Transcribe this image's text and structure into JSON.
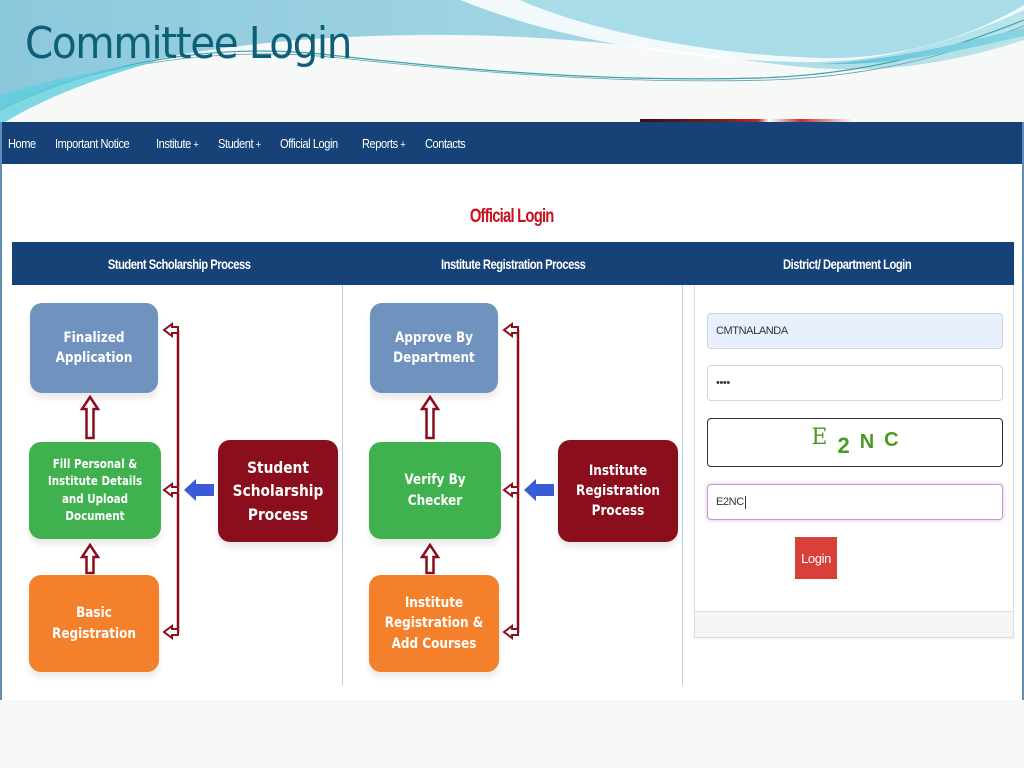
{
  "slide": {
    "title": "Committee Login"
  },
  "navbar": {
    "items": [
      {
        "label": "Home",
        "has_submenu": false
      },
      {
        "label": "Important Notice",
        "has_submenu": false
      },
      {
        "label": "Institute",
        "has_submenu": true
      },
      {
        "label": "Student",
        "has_submenu": true
      },
      {
        "label": "Official Login",
        "has_submenu": false
      },
      {
        "label": "Reports",
        "has_submenu": true
      },
      {
        "label": "Contacts",
        "has_submenu": false
      }
    ],
    "submenu_glyph": "+"
  },
  "page": {
    "heading": "Official Login",
    "tabs": [
      {
        "label": "Student Scholarship Process"
      },
      {
        "label": "Institute Registration Process"
      },
      {
        "label": "District/ Department Login"
      }
    ]
  },
  "student_flow": {
    "steps": [
      {
        "label": "Finalized Application",
        "color": "#6f93be"
      },
      {
        "label": "Fill Personal & Institute Details and Upload Document",
        "color": "#3fb14f"
      },
      {
        "label": "Basic Registration",
        "color": "#f5802b"
      }
    ],
    "source": {
      "label": "Student Scholarship Process",
      "color": "#8a0e1c"
    }
  },
  "institute_flow": {
    "steps": [
      {
        "label": "Approve By Department",
        "color": "#6f93be"
      },
      {
        "label": "Verify By Checker",
        "color": "#3fb14f"
      },
      {
        "label": "Institute Registration & Add Courses",
        "color": "#f5802b"
      }
    ],
    "source": {
      "label": "Institute Registration Process",
      "color": "#8a0e1c"
    }
  },
  "login": {
    "username_value": "CMTNALANDA",
    "password_value": "••••",
    "captcha_chars": [
      "E",
      "2",
      "N",
      "C"
    ],
    "captcha_input_value": "E2NC",
    "submit_label": "Login"
  },
  "colors": {
    "nav_bg": "#164277",
    "heading_red": "#c8101e",
    "login_button": "#d9403a",
    "captcha_green": "#4a9a22",
    "connector": "#8a0e1c",
    "pointer_arrow": "#3b5bd6"
  }
}
